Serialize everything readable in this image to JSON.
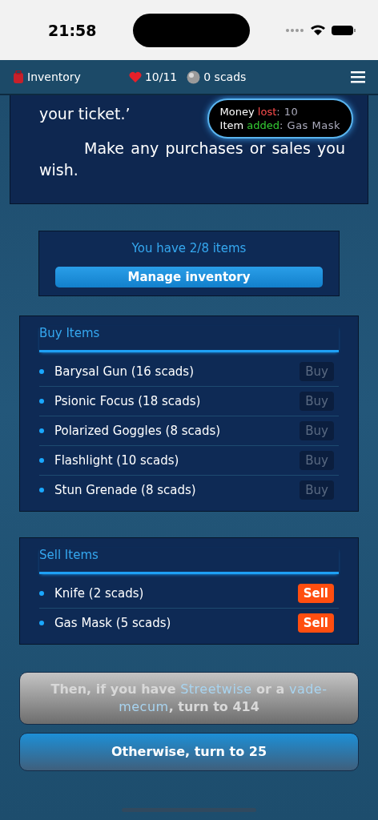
{
  "status_bar": {
    "time": "21:58"
  },
  "header": {
    "inventory_label": "Inventory",
    "health": "10/11",
    "money": "0 scads"
  },
  "story": {
    "paragraphs": [
      "your ticket.’",
      "Make any purchases or sales you wish."
    ]
  },
  "toast": {
    "lines": [
      {
        "label": "Money",
        "verb": "lost",
        "color": "#ff4d4d",
        "value": ": 10"
      },
      {
        "label": "Item",
        "verb": "added",
        "color": "#33cc33",
        "value": ": Gas Mask"
      }
    ]
  },
  "inventory": {
    "count_text": "You have 2/8 items",
    "button": "Manage inventory"
  },
  "buy": {
    "title": "Buy Items",
    "items": [
      {
        "name": "Barysal Gun (16 scads)",
        "action": "Buy",
        "disabled": true
      },
      {
        "name": "Psionic Focus (18 scads)",
        "action": "Buy",
        "disabled": true
      },
      {
        "name": "Polarized Goggles (8 scads)",
        "action": "Buy",
        "disabled": true
      },
      {
        "name": "Flashlight (10 scads)",
        "action": "Buy",
        "disabled": true
      },
      {
        "name": "Stun Grenade (8 scads)",
        "action": "Buy",
        "disabled": true
      }
    ]
  },
  "sell": {
    "title": "Sell Items",
    "items": [
      {
        "name": "Knife (2 scads)",
        "action": "Sell",
        "disabled": false
      },
      {
        "name": "Gas Mask (5 scads)",
        "action": "Sell",
        "disabled": false
      }
    ]
  },
  "choices": [
    {
      "text": "Then, if you have *Streetwise* or a *vade-mecum*, turn to 414",
      "disabled": true
    },
    {
      "text": "Otherwise, turn to 25",
      "disabled": false
    }
  ]
}
